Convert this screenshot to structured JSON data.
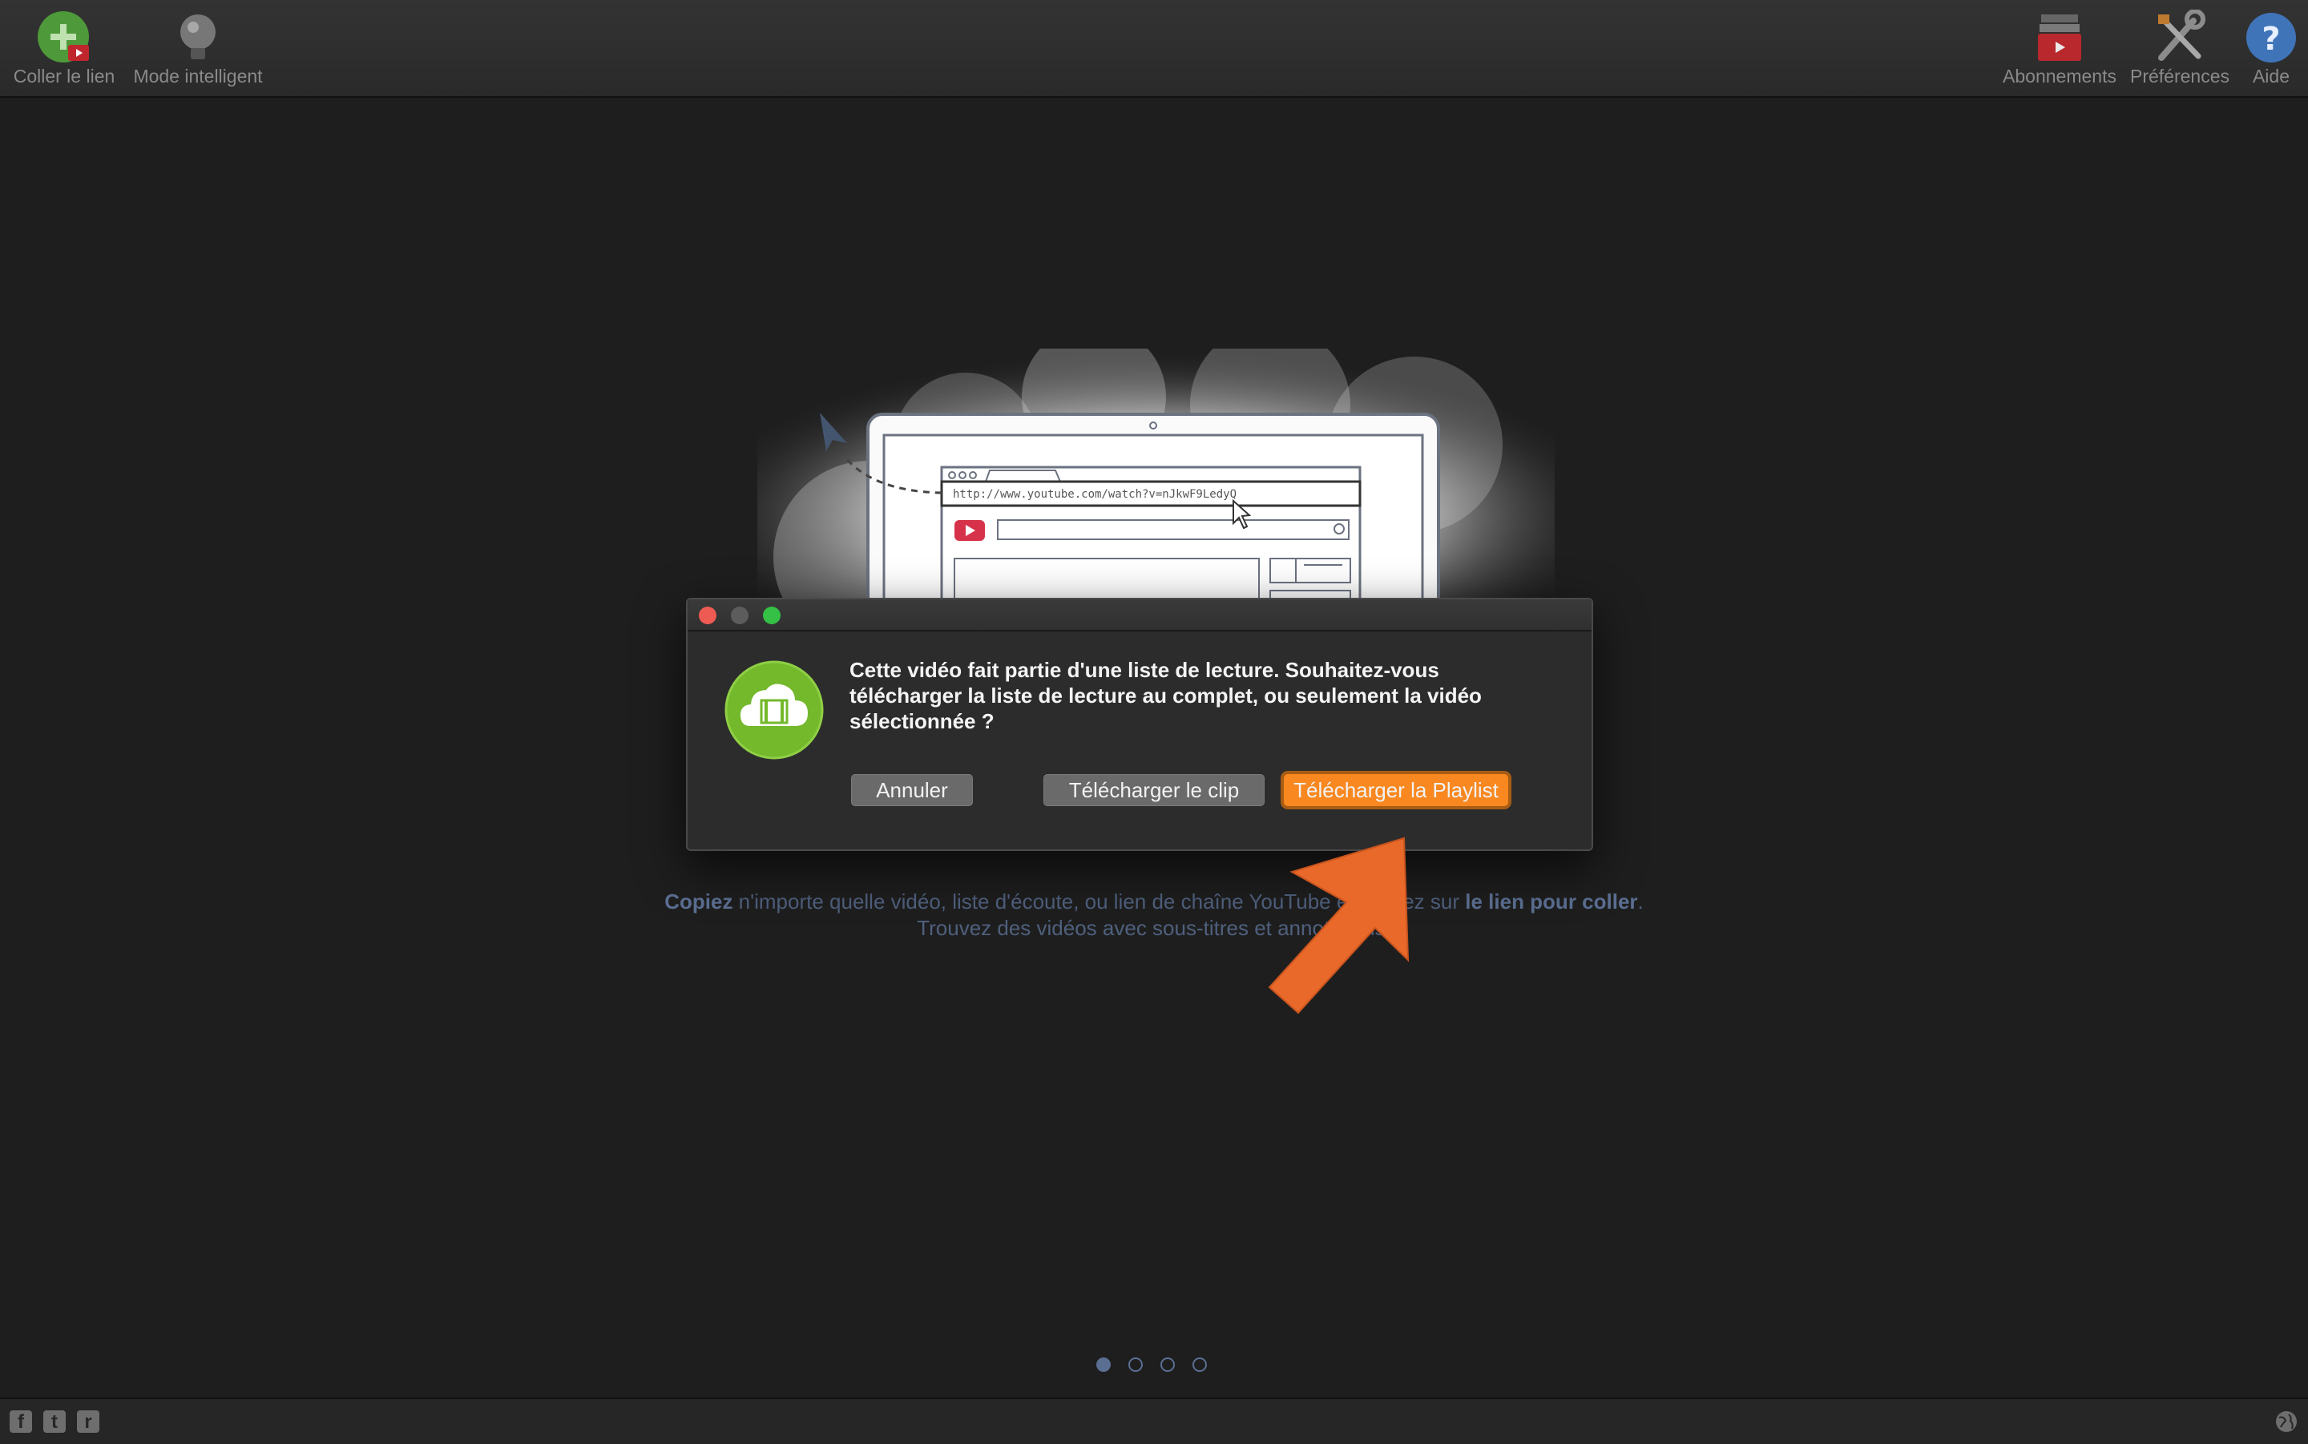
{
  "toolbar": {
    "paste_link": {
      "label": "Coller le lien",
      "icon": "paste-link-icon"
    },
    "smart_mode": {
      "label": "Mode intelligent",
      "icon": "lightbulb-icon"
    },
    "subscriptions": {
      "label": "Abonnements",
      "icon": "subscriptions-icon"
    },
    "preferences": {
      "label": "Préférences",
      "icon": "tools-icon"
    },
    "help": {
      "label": "Aide",
      "icon": "help-icon"
    }
  },
  "illustration": {
    "url": "http://www.youtube.com/watch?v=nJkwF9LedyQ"
  },
  "dialog": {
    "message": "Cette vidéo fait partie d'une liste de lecture. Souhaitez-vous télécharger la liste de lecture au complet, ou seulement la vidéo sélectionnée ?",
    "buttons": {
      "cancel": "Annuler",
      "download_clip": "Télécharger le clip",
      "download_playlist": "Télécharger la Playlist"
    }
  },
  "hint": {
    "line1": [
      {
        "text": "Copiez",
        "bold": true
      },
      {
        "text": " n'importe quelle vidéo, liste d'écoute, ou lien de chaîne YouTube et cliquez sur ",
        "bold": false
      },
      {
        "text": "le lien pour coller",
        "bold": true
      },
      {
        "text": ".",
        "bold": false
      }
    ],
    "line2": "Trouvez des vidéos avec sous-titres et annotations."
  },
  "pager": {
    "count": 4,
    "active": 0
  },
  "footer": {
    "social": [
      "f",
      "t",
      "r"
    ]
  },
  "colors": {
    "accent": "#f8881f",
    "hint": "#5b6f93",
    "arrow": "#e8692a"
  }
}
